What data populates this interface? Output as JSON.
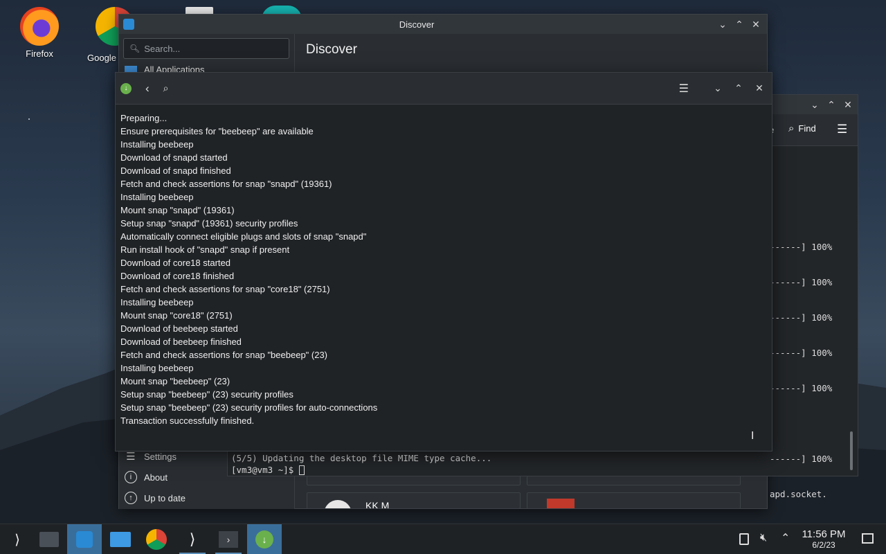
{
  "desktop": {
    "icons": [
      {
        "label": "Firefox"
      },
      {
        "label": "Google"
      }
    ]
  },
  "discover": {
    "window_title": "Discover",
    "page_title": "Discover",
    "search_placeholder": "Search...",
    "partial_nav_label": "All Applications",
    "nav": {
      "settings": "Settings",
      "about": "About",
      "up_to_date": "Up to date"
    },
    "partial_card_text": "KK M"
  },
  "terminal": {
    "find_label": "Find",
    "partial_tab_text": "e",
    "progress_lines": [
      "------] 100%",
      "------] 100%",
      "------] 100%",
      "------] 100%",
      "------] 100%",
      "",
      "------] 100%",
      "apd.socket."
    ],
    "last_output": "(5/5) Updating the desktop file MIME type cache...",
    "prompt": "[vm3@vm3 ~]$ "
  },
  "progress_window": {
    "log": [
      "Preparing...",
      "Ensure prerequisites for \"beebeep\" are available",
      "Installing beebeep",
      "Download of snapd started",
      "Download of snapd finished",
      "Fetch and check assertions for snap \"snapd\" (19361)",
      "Installing beebeep",
      "Mount snap \"snapd\" (19361)",
      "Setup snap \"snapd\" (19361) security profiles",
      "Automatically connect eligible plugs and slots of snap \"snapd\"",
      "Run install hook of \"snapd\" snap if present",
      "Download of core18 started",
      "Download of core18 finished",
      "Fetch and check assertions for snap \"core18\" (2751)",
      "Installing beebeep",
      "Mount snap \"core18\" (2751)",
      "Download of beebeep started",
      "Download of beebeep finished",
      "Fetch and check assertions for snap \"beebeep\" (23)",
      "Installing beebeep",
      "Mount snap \"beebeep\" (23)",
      "Setup snap \"beebeep\" (23) security profiles",
      "Setup snap \"beebeep\" (23) security profiles for auto-connections",
      "Transaction successfully finished."
    ]
  },
  "taskbar": {
    "time": "11:56 PM",
    "date": "6/2/23"
  },
  "colors": {
    "accent": "#3daee9",
    "active_task": "#3a6e9a",
    "window_bg": "#2a2e32"
  }
}
